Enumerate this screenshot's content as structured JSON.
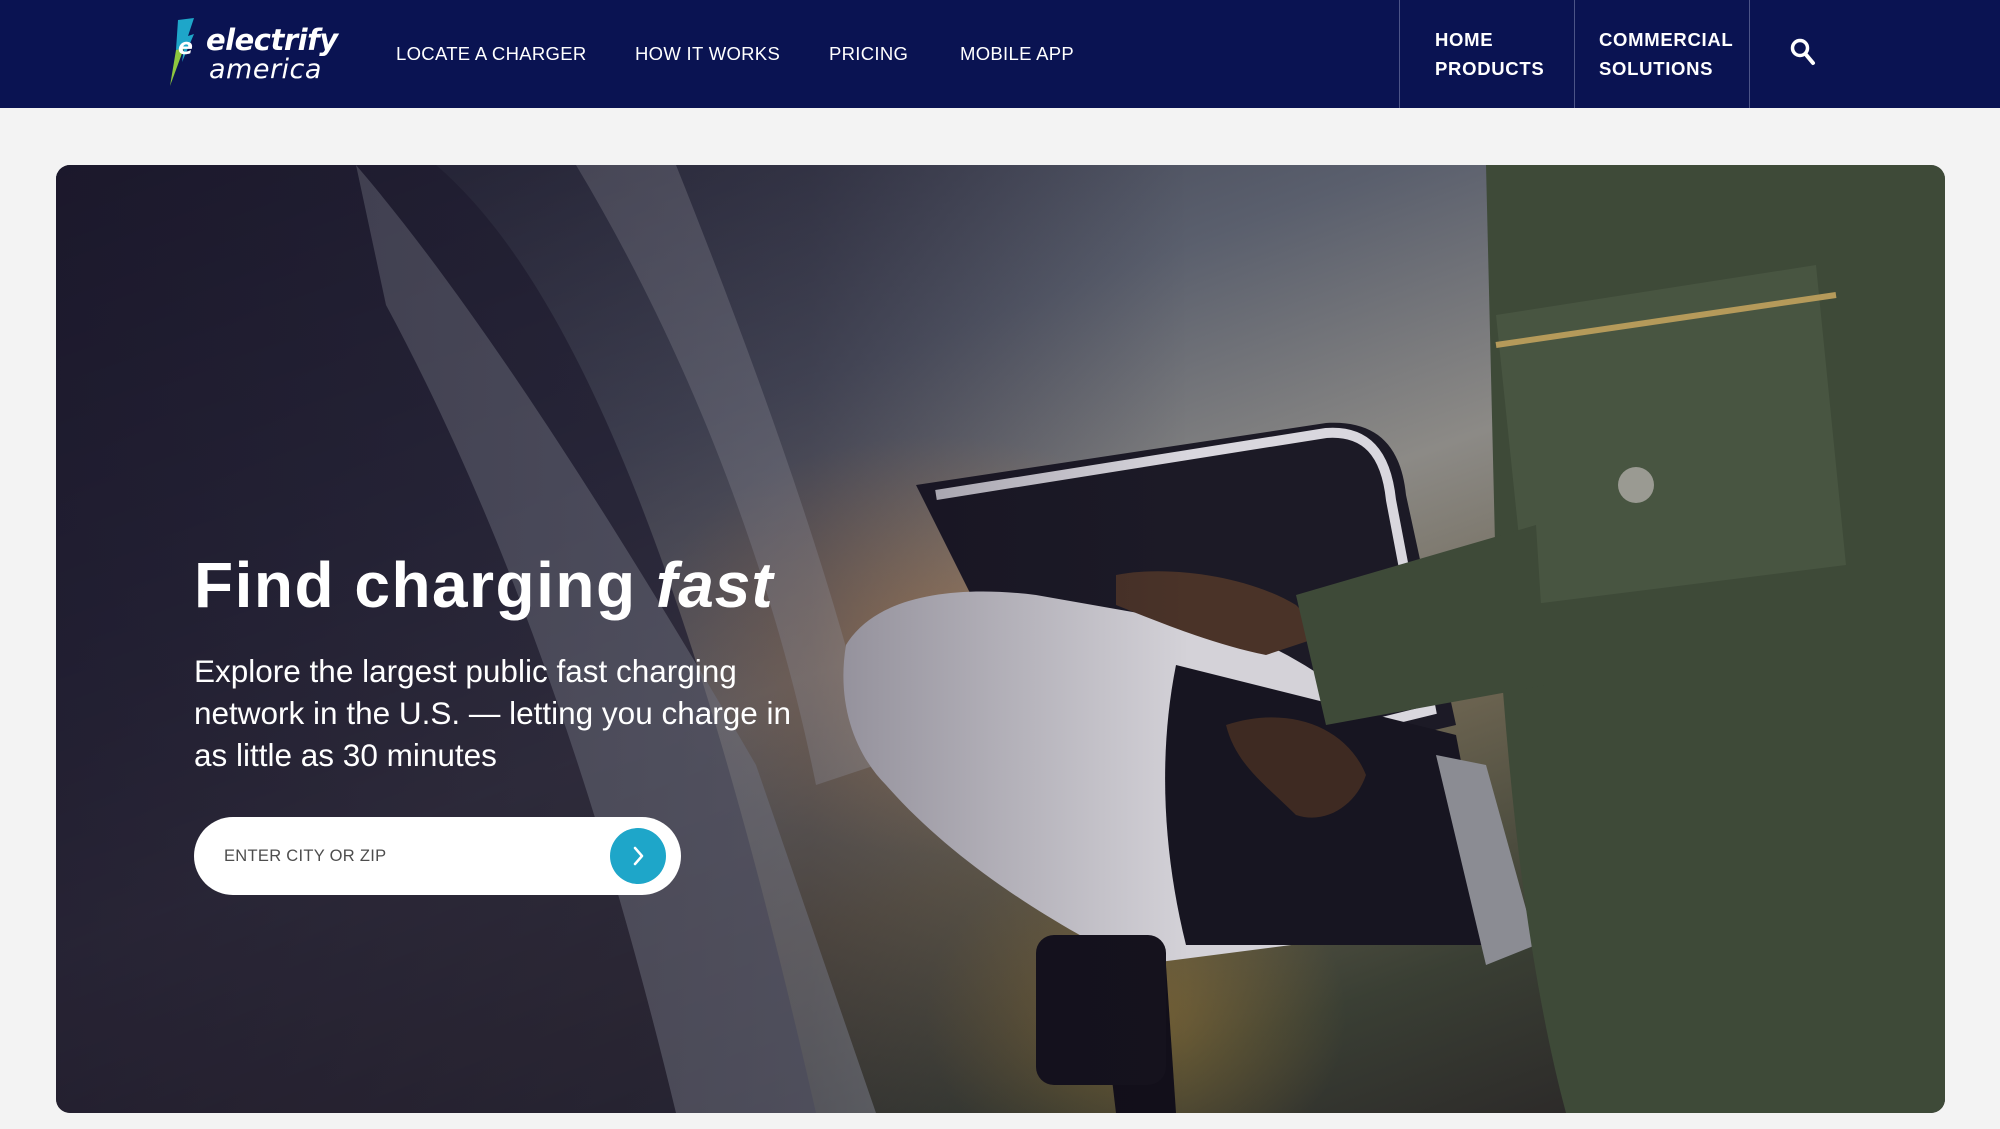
{
  "brand": {
    "line1": "electrify",
    "line2": "america",
    "accent_color": "#0a1352",
    "logo_teal": "#1ea6c9",
    "logo_green": "#8dc63f"
  },
  "nav": {
    "links": [
      {
        "label": "LOCATE A CHARGER"
      },
      {
        "label": "HOW IT WORKS"
      },
      {
        "label": "PRICING"
      },
      {
        "label": "MOBILE APP"
      }
    ],
    "right": [
      {
        "line1": "HOME",
        "line2": "PRODUCTS"
      },
      {
        "line1": "COMMERCIAL",
        "line2": "SOLUTIONS"
      }
    ],
    "search_icon": "search-icon"
  },
  "hero": {
    "title_plain": "Find charging ",
    "title_emph": "fast",
    "subtitle": "Explore the largest public fast charging network in the U.S. — letting you charge in as little as 30 minutes",
    "search": {
      "placeholder": "ENTER CITY OR ZIP",
      "button_icon": "chevron-right-icon",
      "button_color": "#1ea6c9"
    },
    "image": "photo-ev-charging"
  }
}
